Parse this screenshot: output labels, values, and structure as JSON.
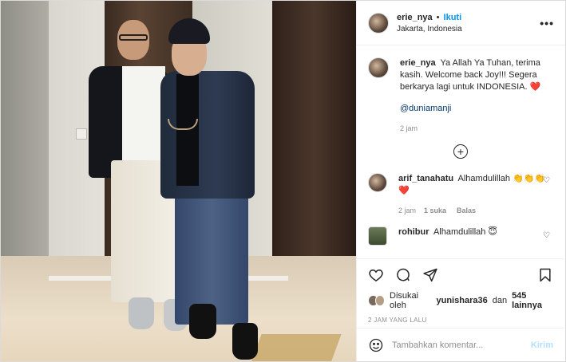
{
  "post": {
    "author": {
      "username": "erie_nya",
      "follow_label": "Ikuti",
      "location": "Jakarta, Indonesia",
      "more_label": "•••"
    },
    "photo_alt": "Two men standing in a hallway",
    "caption": {
      "username": "erie_nya",
      "text": "Ya Allah Ya Tuhan, terima kasih. Welcome back Joy!!! Segera berkarya lagi untuk INDONESIA. ❤️",
      "mention": "@duniamanji",
      "time": "2 jam"
    },
    "load_more_label": "+",
    "comments": [
      {
        "username": "arif_tanahatu",
        "text": "Alhamdulillah 👏👏👏❤️",
        "time": "2 jam",
        "likes": "1 suka",
        "reply": "Balas",
        "heart": "♡"
      },
      {
        "username": "rohibur",
        "text": "Alhamdulillah 😇",
        "heart": "♡"
      }
    ],
    "likes": {
      "prefix": "Disukai oleh",
      "user": "yunishara36",
      "joiner": "dan",
      "others": "545 lainnya"
    },
    "timestamp": "2 JAM YANG LALU",
    "add_comment": {
      "placeholder": "Tambahkan komentar...",
      "send_label": "Kirim"
    },
    "icons": {
      "like": "heart-icon",
      "comment": "comment-icon",
      "share": "share-icon",
      "save": "bookmark-icon",
      "emoji": "emoji-icon"
    }
  }
}
